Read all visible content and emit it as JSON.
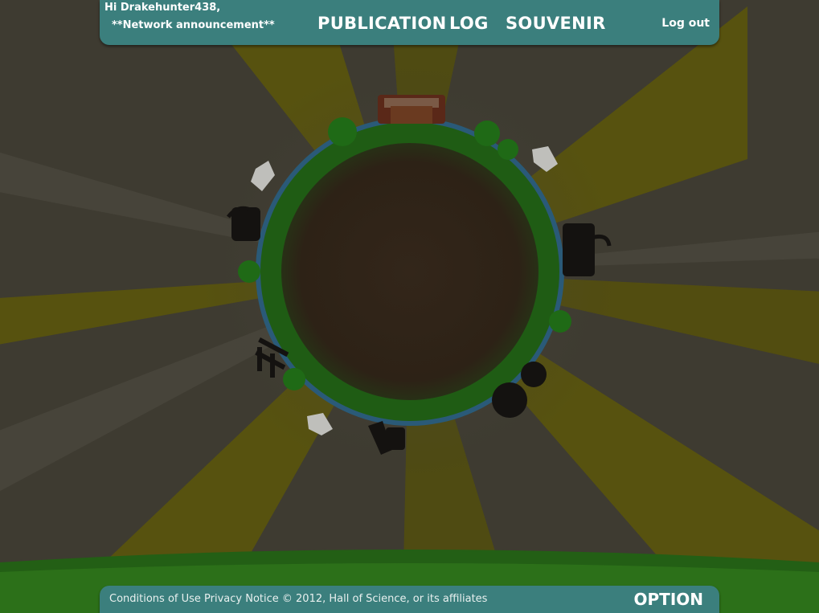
{
  "header": {
    "greeting": "Hi Drakehunter438,",
    "announcement": "**Network announcement**",
    "nav": [
      "PUBLICATION",
      "LOG",
      "SOUVENIR"
    ],
    "logout": "Log out"
  },
  "footer": {
    "conditions": "Conditions of Use",
    "privacy": "Privacy Notice",
    "copyright": "© 2012, Hall of Science, or its affiliates",
    "option": "OPTION"
  },
  "colors": {
    "bar": "#3b7f7d",
    "planet_ring": "#1f5c14",
    "planet_core": "#2f2316",
    "ground": "#235f15",
    "ray": "#57520f"
  }
}
